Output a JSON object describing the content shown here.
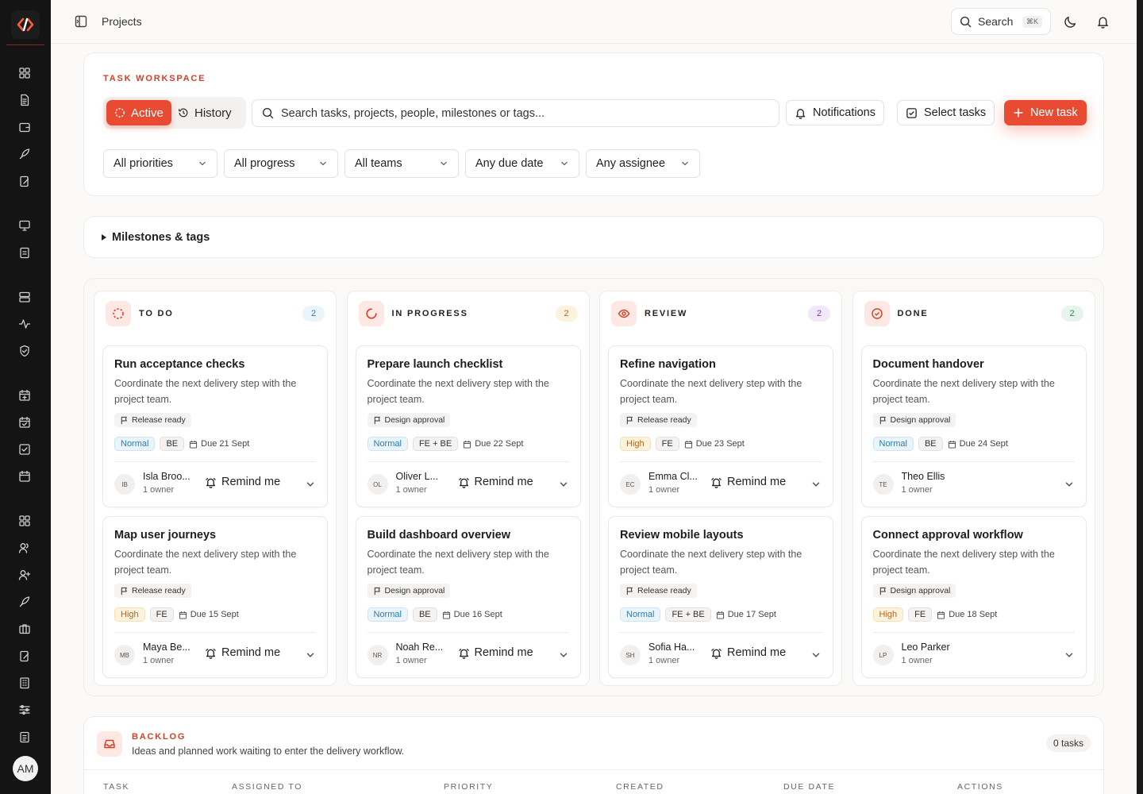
{
  "topbar": {
    "title": "Projects",
    "search_label": "Search",
    "search_kbd": "⌘K"
  },
  "user": {
    "initials": "AM"
  },
  "workspace": {
    "eyebrow": "TASK WORKSPACE",
    "toggle": {
      "active": "Active",
      "history": "History"
    },
    "search_placeholder": "Search tasks, projects, people, milestones or tags...",
    "buttons": {
      "notifications": "Notifications",
      "select": "Select tasks",
      "new": "New task"
    },
    "filters": [
      "All priorities",
      "All progress",
      "All teams",
      "Any due date",
      "Any assignee"
    ]
  },
  "milestones": {
    "label": "Milestones & tags"
  },
  "board": {
    "columns": [
      {
        "title": "TO DO",
        "count": "2",
        "icon": "circle-dashed-icon",
        "count_color": "#2c7bb6",
        "count_bg": "#eaf4fb",
        "cards": [
          {
            "title": "Run acceptance checks",
            "desc": "Coordinate the next delivery step with the project team.",
            "milestone": "Release ready",
            "priority": "Normal",
            "team": "BE",
            "due": "Due 21 Sept",
            "initials": "IB",
            "owner": "Isla Broo...",
            "owner_sub": "1 owner",
            "remind": "Remind me"
          },
          {
            "title": "Map user journeys",
            "desc": "Coordinate the next delivery step with the project team.",
            "milestone": "Release ready",
            "priority": "High",
            "team": "FE",
            "due": "Due 15 Sept",
            "initials": "MB",
            "owner": "Maya Be...",
            "owner_sub": "1 owner",
            "remind": "Remind me"
          }
        ]
      },
      {
        "title": "IN PROGRESS",
        "count": "2",
        "icon": "loader-icon",
        "count_color": "#b5651d",
        "count_bg": "#fdf3dc",
        "cards": [
          {
            "title": "Prepare launch checklist",
            "desc": "Coordinate the next delivery step with the project team.",
            "milestone": "Design approval",
            "priority": "Normal",
            "team": "FE + BE",
            "due": "Due 22 Sept",
            "initials": "OL",
            "owner": "Oliver L...",
            "owner_sub": "1 owner",
            "remind": "Remind me"
          },
          {
            "title": "Build dashboard overview",
            "desc": "Coordinate the next delivery step with the project team.",
            "milestone": "Design approval",
            "priority": "Normal",
            "team": "BE",
            "due": "Due 16 Sept",
            "initials": "NR",
            "owner": "Noah Re...",
            "owner_sub": "1 owner",
            "remind": "Remind me"
          }
        ]
      },
      {
        "title": "REVIEW",
        "count": "2",
        "icon": "eye-icon",
        "count_color": "#7b3fb0",
        "count_bg": "#f1e8fa",
        "cards": [
          {
            "title": "Refine navigation",
            "desc": "Coordinate the next delivery step with the project team.",
            "milestone": "Release ready",
            "priority": "High",
            "team": "FE",
            "due": "Due 23 Sept",
            "initials": "EC",
            "owner": "Emma Cl...",
            "owner_sub": "1 owner",
            "remind": "Remind me"
          },
          {
            "title": "Review mobile layouts",
            "desc": "Coordinate the next delivery step with the project team.",
            "milestone": "Release ready",
            "priority": "Normal",
            "team": "FE + BE",
            "due": "Due 17 Sept",
            "initials": "SH",
            "owner": "Sofia Ha...",
            "owner_sub": "1 owner",
            "remind": "Remind me"
          }
        ]
      },
      {
        "title": "DONE",
        "count": "2",
        "icon": "check-circle-icon",
        "count_color": "#2f8a4f",
        "count_bg": "#e6f5ec",
        "cards": [
          {
            "title": "Document handover",
            "desc": "Coordinate the next delivery step with the project team.",
            "milestone": "Design approval",
            "priority": "Normal",
            "team": "BE",
            "due": "Due 24 Sept",
            "initials": "TE",
            "owner": "Theo Ellis",
            "owner_sub": "1 owner",
            "remind": ""
          },
          {
            "title": "Connect approval workflow",
            "desc": "Coordinate the next delivery step with the project team.",
            "milestone": "Design approval",
            "priority": "High",
            "team": "FE",
            "due": "Due 18 Sept",
            "initials": "LP",
            "owner": "Leo Parker",
            "owner_sub": "1 owner",
            "remind": ""
          }
        ]
      }
    ]
  },
  "backlog": {
    "title": "BACKLOG",
    "desc": "Ideas and planned work waiting to enter the delivery workflow.",
    "count": "0 tasks",
    "headers": [
      "TASK",
      "ASSIGNED TO",
      "PRIORITY",
      "CREATED",
      "DUE DATE",
      "ACTIONS"
    ]
  },
  "colors": {
    "accent": "#e84a32",
    "sidebar": "#141414"
  }
}
